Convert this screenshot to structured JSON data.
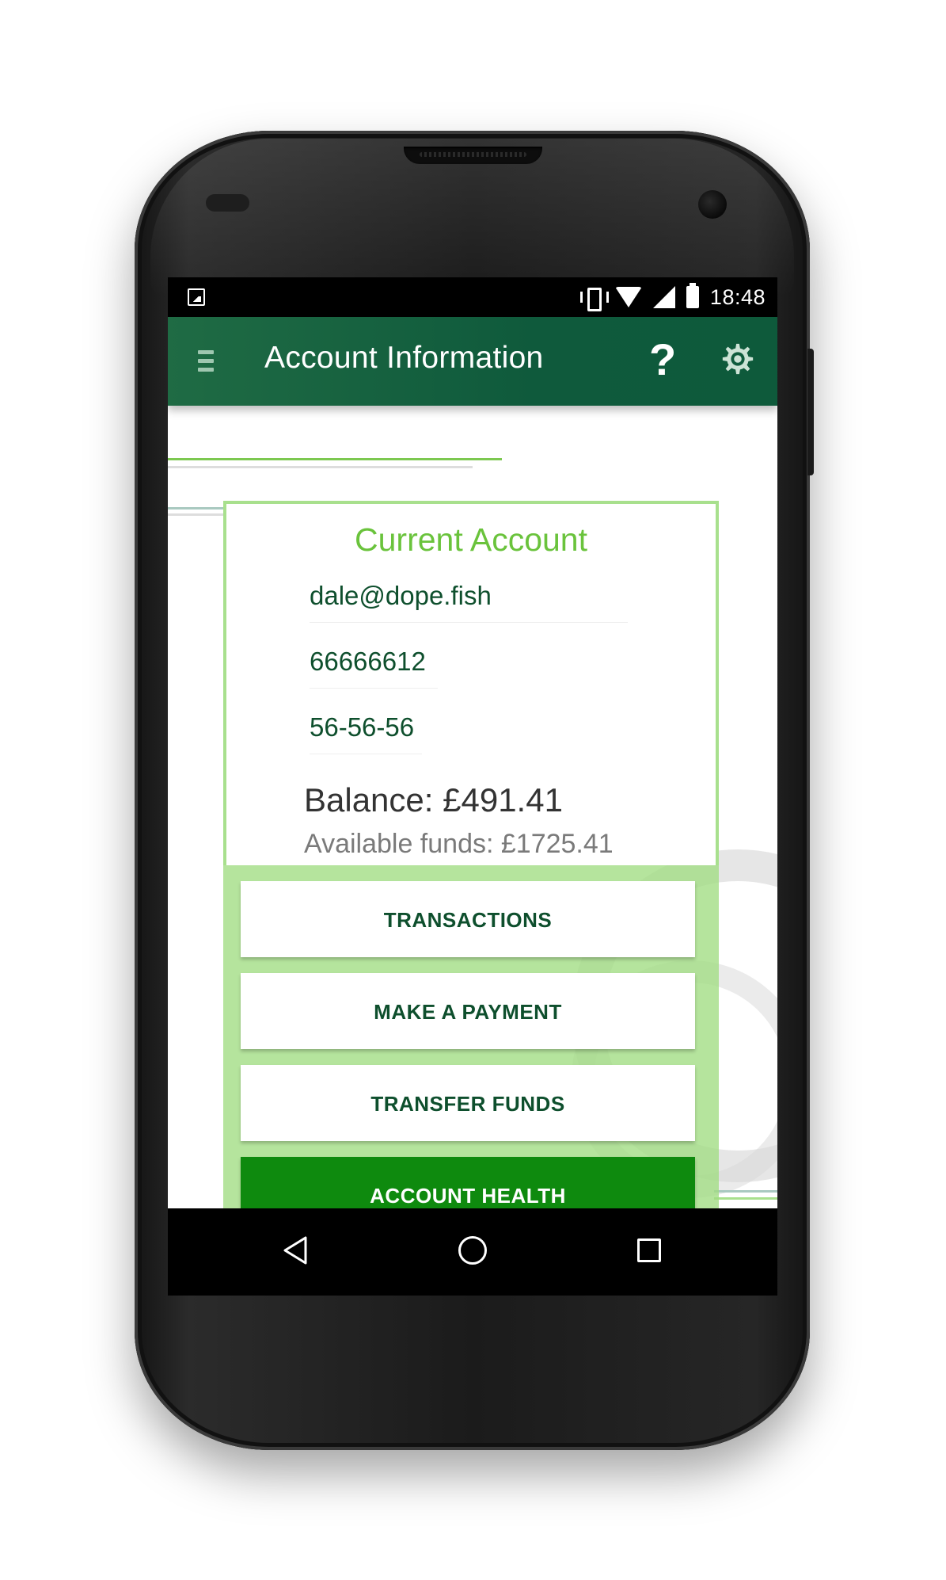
{
  "status_bar": {
    "time": "18:48",
    "icons": [
      "image-notification-icon",
      "vibrate-icon",
      "wifi-icon",
      "signal-icon",
      "battery-icon"
    ]
  },
  "app_bar": {
    "title": "Account Information",
    "menu_icon": "hamburger-menu-icon",
    "help_label": "?",
    "settings_icon": "gear-icon",
    "background_color": "#0f5a3c"
  },
  "account": {
    "type": "Current Account",
    "email": "dale@dope.fish",
    "account_number": "66666612",
    "sort_code": "56-56-56",
    "balance": "Balance: £491.41",
    "available_funds": "Available funds: £1725.41"
  },
  "actions": {
    "transactions": "TRANSACTIONS",
    "make_payment": "MAKE A PAYMENT",
    "transfer_funds": "TRANSFER FUNDS",
    "account_health": "ACCOUNT HEALTH"
  },
  "colors": {
    "accent_green": "#6ac33c",
    "dark_green": "#0e4f2d",
    "button_panel": "#a0dc82",
    "primary_button": "#0e8a0e"
  },
  "nav_bar": {
    "icons": [
      "back-icon",
      "home-icon",
      "recents-icon"
    ]
  }
}
